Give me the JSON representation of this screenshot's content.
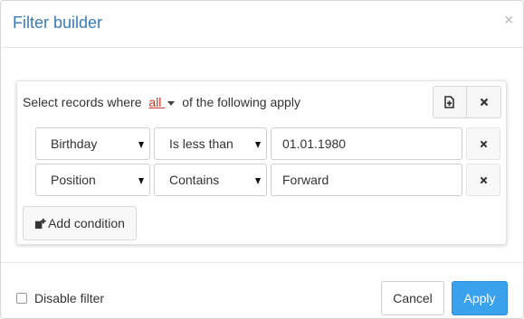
{
  "dialog": {
    "title": "Filter builder",
    "close_glyph": "×"
  },
  "group": {
    "prefix": "Select records where",
    "combinator": "all",
    "suffix": "of the following apply",
    "add_group_icon": "add-group-icon",
    "remove_icon": "close-icon"
  },
  "conditions": [
    {
      "field": "Birthday",
      "operator": "Is less than",
      "value": "01.01.1980"
    },
    {
      "field": "Position",
      "operator": "Contains",
      "value": "Forward"
    }
  ],
  "add_condition_label": "Add condition",
  "footer": {
    "disable_label": "Disable filter",
    "disable_checked": false,
    "cancel_label": "Cancel",
    "apply_label": "Apply"
  },
  "colors": {
    "title": "#3a7bb4",
    "link": "#c0392b",
    "primary": "#3aa1ec"
  }
}
